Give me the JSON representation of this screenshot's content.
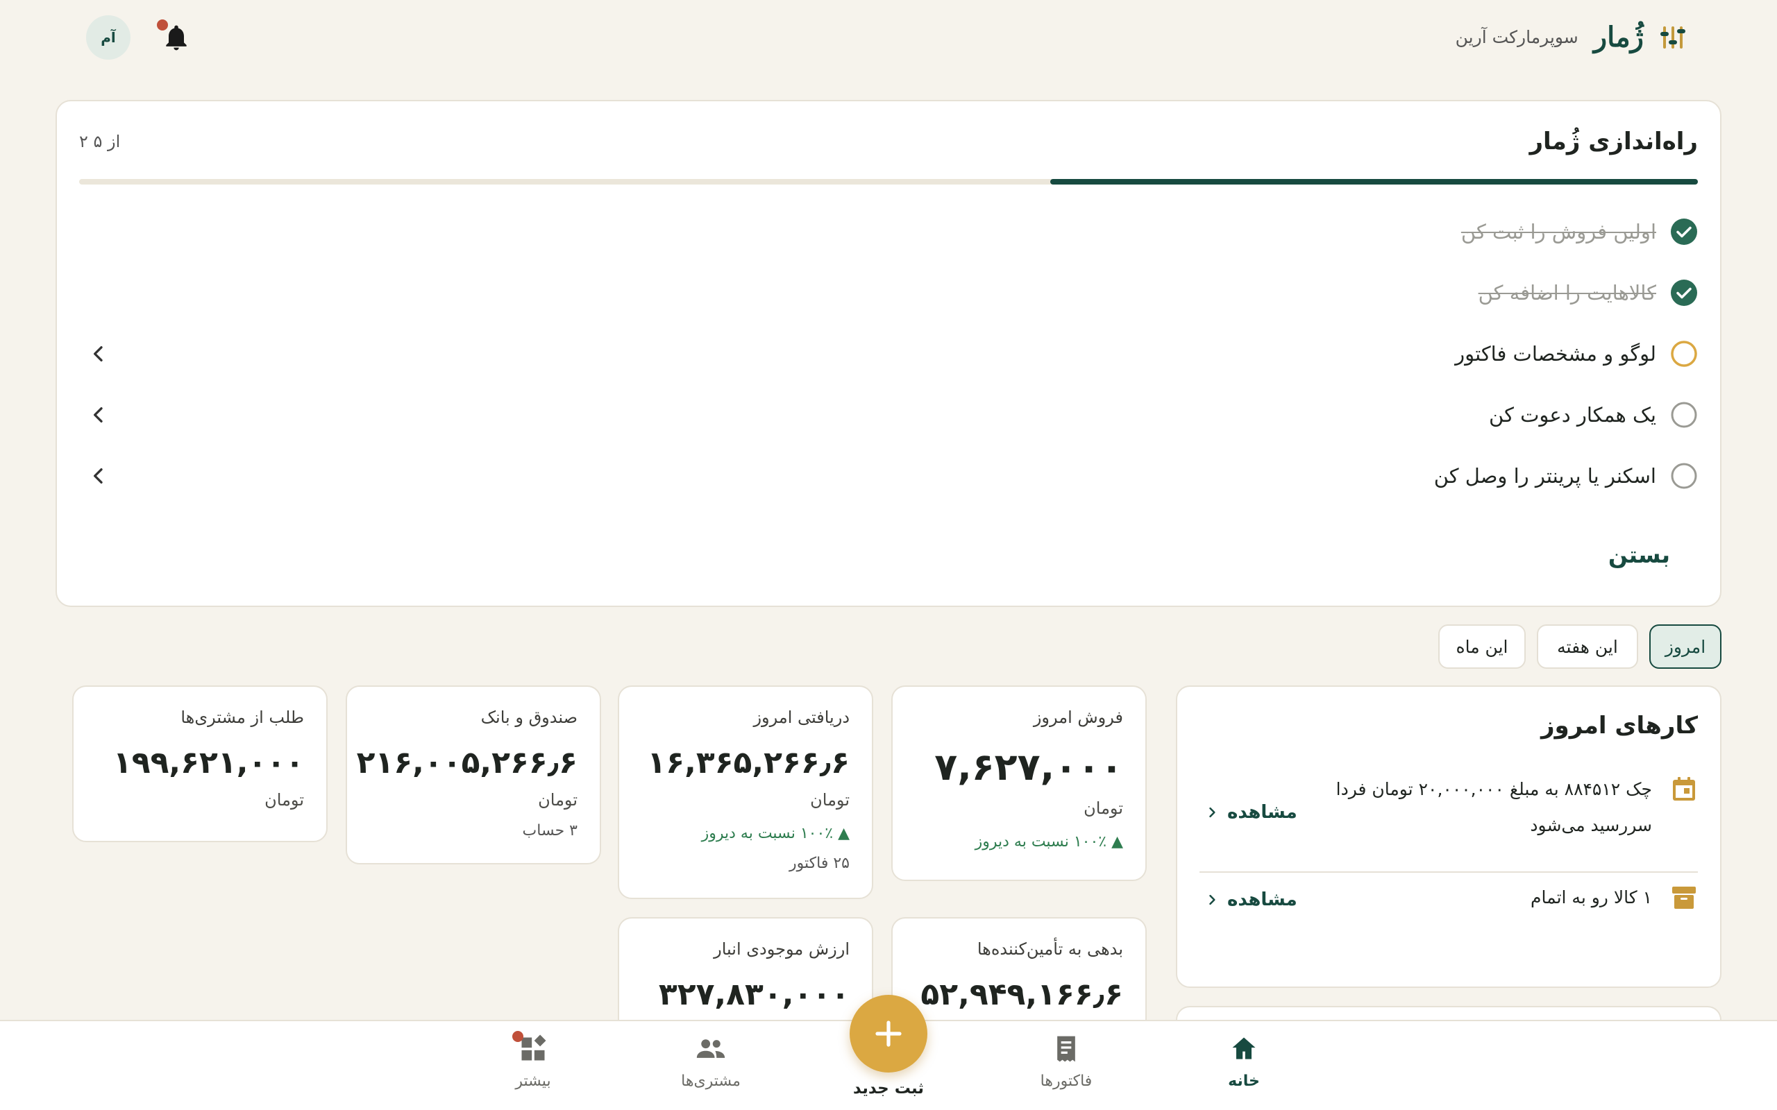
{
  "header": {
    "brand": "ژُمار",
    "store": "سوپرمارکت آرین",
    "avatar": "آم"
  },
  "setup": {
    "title": "راه‌اندازی ژُمار",
    "step": "۲ از ۵",
    "progress": 0.4,
    "tasks": [
      {
        "label": "اولین فروش را ثبت کن",
        "done": true
      },
      {
        "label": "کالاهایت را اضافه کن",
        "done": true
      },
      {
        "label": "لوگو و مشخصات فاکتور",
        "done": false
      },
      {
        "label": "یک همکار دعوت کن",
        "done": false
      },
      {
        "label": "اسکنر یا پرینتر را وصل کن",
        "done": false
      }
    ],
    "close": "بستن"
  },
  "tabs": [
    "امروز",
    "این هفته",
    "این ماه"
  ],
  "stats": {
    "sales": {
      "title": "فروش امروز",
      "value": "۷,۶۲۷,۰۰۰",
      "unit": "تومان",
      "delta": "▲ ۱۰۰٪ نسبت به دیروز"
    },
    "received": {
      "title": "دریافتی امروز",
      "value": "۱۶,۳۶۵,۲۶۶٫۶",
      "unit": "تومان",
      "delta": "▲ ۱۰۰٪ نسبت به دیروز",
      "sub": "۲۵ فاکتور"
    },
    "cash": {
      "title": "صندوق و بانک",
      "value": "۲۱۶,۰۰۵,۲۶۶٫۶",
      "unit": "تومان",
      "sub": "۳ حساب"
    },
    "receivable": {
      "title": "طلب از مشتری‌ها",
      "value": "۱۹۹,۶۲۱,۰۰۰",
      "unit": "تومان"
    },
    "payable": {
      "title": "بدهی به تأمین‌کننده‌ها",
      "value": "۵۲,۹۴۹,۱۶۶٫۶"
    },
    "inventory": {
      "title": "ارزش موجودی انبار",
      "value": "۳۲۷,۸۳۰,۰۰۰"
    }
  },
  "today": {
    "title": "کارهای امروز",
    "items": [
      {
        "text": "چک ۸۸۴۵۱۲ به مبلغ ۲۰,۰۰۰,۰۰۰ تومان فردا سررسید می‌شود",
        "link": "مشاهده"
      },
      {
        "text": "۱ کالا رو به اتمام",
        "link": "مشاهده"
      }
    ]
  },
  "nav": {
    "home": "خانه",
    "invoices": "فاکتورها",
    "new": "ثبت جدید",
    "customers": "مشتری‌ها",
    "more": "بیشتر"
  },
  "colors": {
    "primary": "#174a40",
    "accent": "#dba842",
    "alert": "#c0503a",
    "background": "#f6f3ec"
  }
}
